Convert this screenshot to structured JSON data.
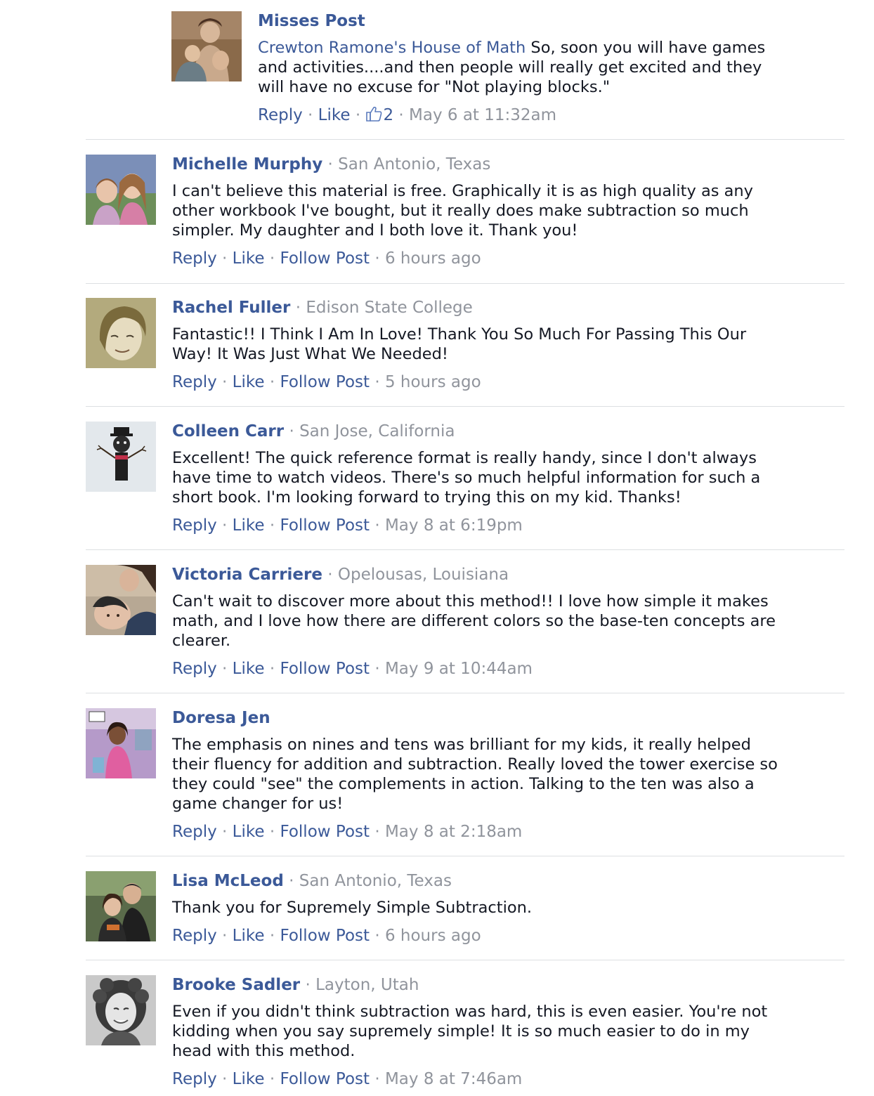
{
  "reply_comment": {
    "name": "Misses Post",
    "tag": "Crewton Ramone's House of Math",
    "text": " So, soon you will have games\nand activities....and then people will really get excited and they\nwill have no excuse for \"Not playing blocks.\"",
    "actions": {
      "reply": "Reply",
      "like": "Like",
      "like_count": "2",
      "time": "May 6 at 11:32am"
    },
    "avatar_icon": "painting-avatar"
  },
  "comments": [
    {
      "name": "Michelle Murphy",
      "location": "San Antonio, Texas",
      "text": "I can't believe this material is free. Graphically it is as high quality as any\nother workbook I've bought, but it really does make subtraction so much\nsimpler. My daughter and I both love it. Thank you!",
      "reply": "Reply",
      "like": "Like",
      "follow": "Follow Post",
      "time": "6 hours ago"
    },
    {
      "name": "Rachel Fuller",
      "location": "Edison State College",
      "text": "Fantastic!! I Think I Am In Love! Thank You So Much For Passing This Our\nWay! It Was Just What We Needed!",
      "reply": "Reply",
      "like": "Like",
      "follow": "Follow Post",
      "time": "5 hours ago"
    },
    {
      "name": "Colleen Carr",
      "location": "San Jose, California",
      "text": "Excellent! The quick reference format is really handy, since I don't always\nhave time to watch videos. There's so much helpful information for such a\nshort book. I'm looking forward to trying this on my kid. Thanks!",
      "reply": "Reply",
      "like": "Like",
      "follow": "Follow Post",
      "time": "May 8 at 6:19pm"
    },
    {
      "name": "Victoria Carriere",
      "location": "Opelousas, Louisiana",
      "text": "Can't wait to discover more about this method!! I love how simple it makes\nmath, and I love how there are different colors so the base-ten concepts are\nclearer.",
      "reply": "Reply",
      "like": "Like",
      "follow": "Follow Post",
      "time": "May 9 at 10:44am"
    },
    {
      "name": "Doresa Jen",
      "location": "",
      "text": "The emphasis on nines and tens was brilliant for my kids, it really helped\ntheir fluency for addition and subtraction. Really loved the tower exercise so\nthey could \"see\" the complements in action. Talking to the ten was also a\ngame changer for us!",
      "reply": "Reply",
      "like": "Like",
      "follow": "Follow Post",
      "time": "May 8 at 2:18am"
    },
    {
      "name": "Lisa McLeod",
      "location": "San Antonio, Texas",
      "text": "Thank you for Supremely Simple Subtraction.",
      "reply": "Reply",
      "like": "Like",
      "follow": "Follow Post",
      "time": "6 hours ago"
    },
    {
      "name": "Brooke Sadler",
      "location": "Layton, Utah",
      "text": "Even if you didn't think subtraction was hard, this is even easier. You're not\nkidding when you say supremely simple! It is so much easier to do in my\nhead with this method.",
      "reply": "Reply",
      "like": "Like",
      "follow": "Follow Post",
      "time": "May 8 at 7:46am"
    }
  ],
  "separator": "·",
  "colors": {
    "link": "#3b5998",
    "meta": "#90949c",
    "text": "#141823",
    "divider": "#dddfe2"
  }
}
